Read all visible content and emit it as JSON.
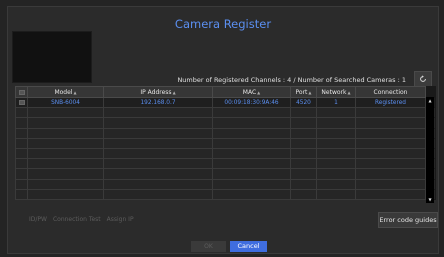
{
  "dialog": {
    "title": "Camera Register",
    "info": "Number of Registered Channels : 4 / Number of Searched Cameras : 1",
    "refresh_icon": "refresh-icon"
  },
  "table": {
    "columns": [
      "",
      "Model",
      "IP Address",
      "MAC",
      "Port",
      "Network",
      "Connection"
    ],
    "rows": [
      {
        "model": "SNB-6004",
        "ip": "192.168.0.7",
        "mac": "00:09:18:30:9A:46",
        "port": "4520",
        "network": "1",
        "connection": "Registered"
      }
    ],
    "empty_rows": 9
  },
  "buttons": {
    "idpw": "ID/PW",
    "connection_test": "Connection Test",
    "assign_ip": "Assign IP",
    "error_code_guides": "Error code guides",
    "ok": "OK",
    "cancel": "Cancel"
  },
  "colors": {
    "accent": "#5b8ff0",
    "cancel_bg": "#3f6ddf",
    "background": "#242424"
  }
}
